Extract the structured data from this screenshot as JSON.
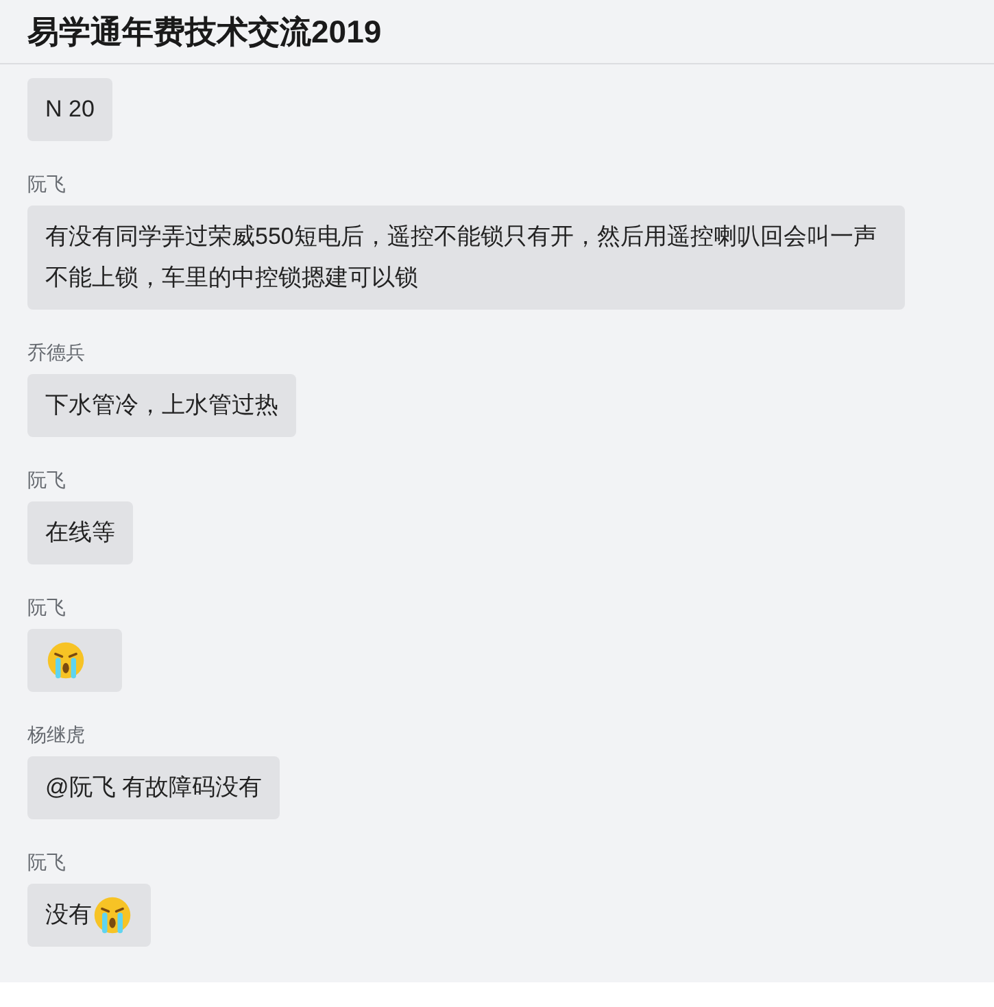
{
  "title": "易学通年费技术交流2019",
  "messages": [
    {
      "text": "N 20",
      "emoji": false
    },
    {
      "sender": "阮飞",
      "text": "有没有同学弄过荣威550短电后，遥控不能锁只有开，然后用遥控喇叭回会叫一声不能上锁，车里的中控锁摁建可以锁",
      "emoji": false
    },
    {
      "sender": "乔德兵",
      "text": "下水管冷，上水管过热",
      "emoji": false
    },
    {
      "sender": "阮飞",
      "text": "在线等",
      "emoji": false
    },
    {
      "sender": "阮飞",
      "emoji": true
    },
    {
      "sender": "杨继虎",
      "text": "@阮飞 有故障码没有",
      "emoji": false
    },
    {
      "sender": "阮飞",
      "text": "没有",
      "emoji": true
    }
  ]
}
